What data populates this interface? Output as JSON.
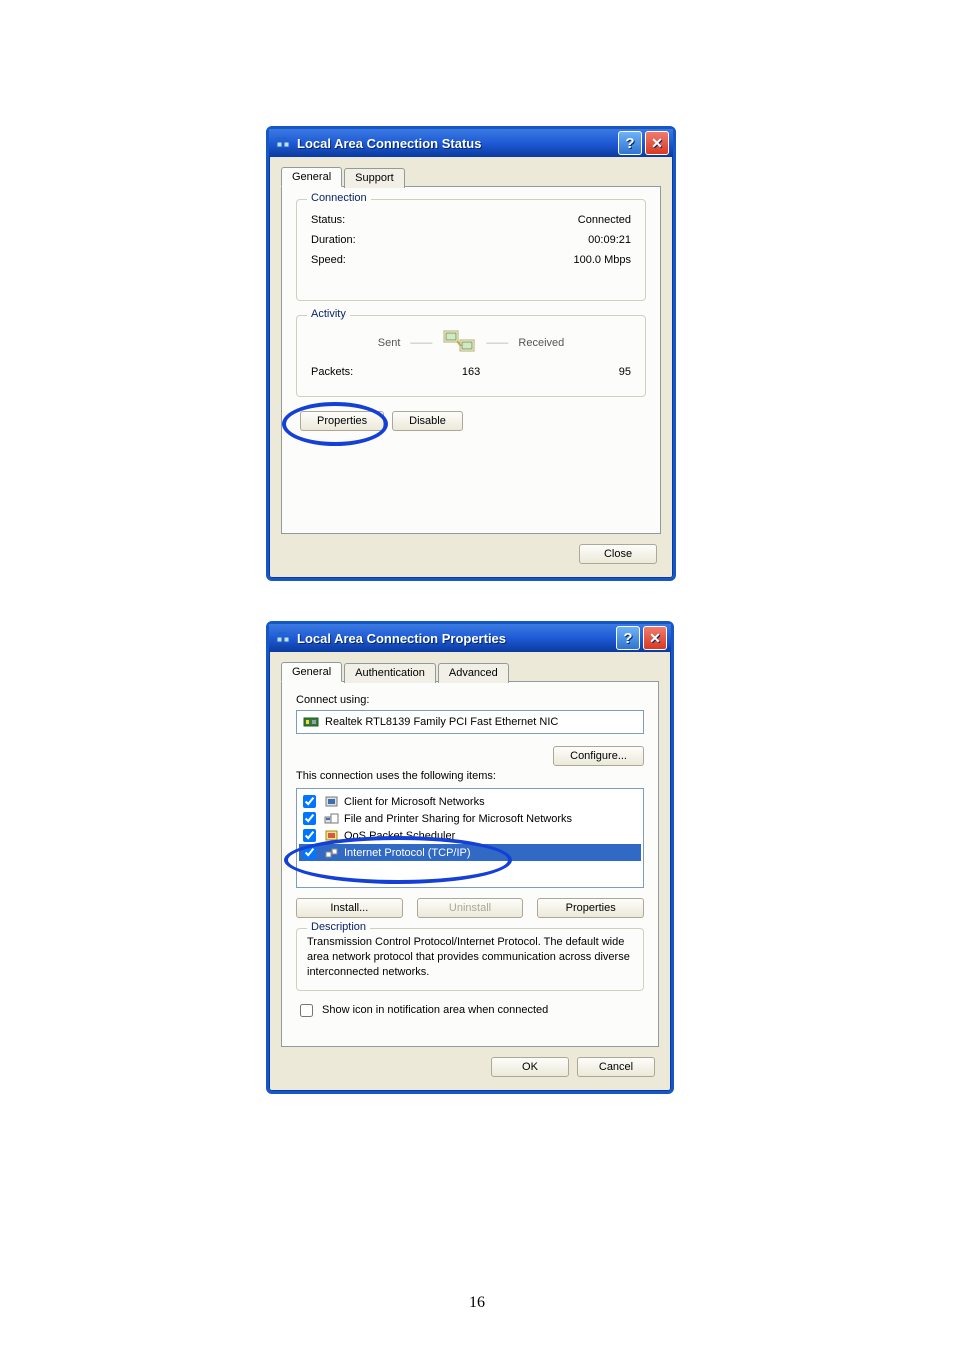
{
  "page_number": "16",
  "status": {
    "title": "Local Area Connection Status",
    "tabs": {
      "general": "General",
      "support": "Support"
    },
    "connection": {
      "legend": "Connection",
      "status_label": "Status:",
      "status_value": "Connected",
      "duration_label": "Duration:",
      "duration_value": "00:09:21",
      "speed_label": "Speed:",
      "speed_value": "100.0 Mbps"
    },
    "activity": {
      "legend": "Activity",
      "sent": "Sent",
      "received": "Received",
      "packets_label": "Packets:",
      "packets_sent": "163",
      "packets_received": "95"
    },
    "buttons": {
      "properties": "Properties",
      "disable": "Disable",
      "close": "Close"
    }
  },
  "props": {
    "title": "Local Area Connection Properties",
    "tabs": {
      "general": "General",
      "auth": "Authentication",
      "adv": "Advanced"
    },
    "connect_using_label": "Connect using:",
    "adapter": "Realtek RTL8139 Family PCI Fast Ethernet NIC",
    "configure": "Configure...",
    "items_label": "This connection uses the following items:",
    "items": [
      {
        "label": "Client for Microsoft Networks",
        "checked": true
      },
      {
        "label": "File and Printer Sharing for Microsoft Networks",
        "checked": true
      },
      {
        "label": "QoS Packet Scheduler",
        "checked": true
      },
      {
        "label": "Internet Protocol (TCP/IP)",
        "checked": true,
        "selected": true
      }
    ],
    "install": "Install...",
    "uninstall": "Uninstall",
    "properties": "Properties",
    "description": {
      "legend": "Description",
      "text": "Transmission Control Protocol/Internet Protocol. The default wide area network protocol that provides communication across diverse interconnected networks."
    },
    "show_icon": "Show icon in notification area when connected",
    "ok": "OK",
    "cancel": "Cancel"
  }
}
